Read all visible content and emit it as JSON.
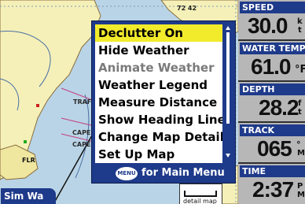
{
  "map": {
    "top_number": "72 42",
    "labels": {
      "traff": "TRAFF",
      "cape1": "CAPE",
      "cape2": "CAPE",
      "flr": "FLR"
    },
    "sim_label": "Sim Wa",
    "scale_label": "detail map"
  },
  "menu": {
    "items": [
      {
        "label": "Declutter On",
        "state": "selected"
      },
      {
        "label": "Hide Weather",
        "state": "enabled"
      },
      {
        "label": "Animate Weather",
        "state": "disabled"
      },
      {
        "label": "Weather Legend",
        "state": "enabled"
      },
      {
        "label": "Measure Distance",
        "state": "enabled"
      },
      {
        "label": "Show Heading Line",
        "state": "enabled"
      },
      {
        "label": "Change Map Detail",
        "state": "enabled"
      },
      {
        "label": "Set Up Map",
        "state": "enabled"
      }
    ],
    "footer_key": "MENU",
    "footer_text": "for Main Menu"
  },
  "data_fields": [
    {
      "label": "SPEED",
      "value": "30.0",
      "unit_top": "k",
      "unit_bottom": "t"
    },
    {
      "label": "WATER TEMP",
      "value": "61.0",
      "unit_top": "",
      "unit_bottom": "°F"
    },
    {
      "label": "DEPTH",
      "value": "28.2",
      "unit_top": "f",
      "unit_bottom": "t"
    },
    {
      "label": "TRACK",
      "value": "065",
      "unit_top": "°",
      "unit_bottom": "M"
    },
    {
      "label": "TIME",
      "value": "2:37",
      "unit_top": "P",
      "unit_bottom": "M"
    }
  ],
  "colors": {
    "menu_bg": "#1e3a8a",
    "selected_bg": "#f2eb2c",
    "field_bg": "#b7b7b7",
    "water": "#b9d4e6",
    "land": "#f5f0b8"
  }
}
